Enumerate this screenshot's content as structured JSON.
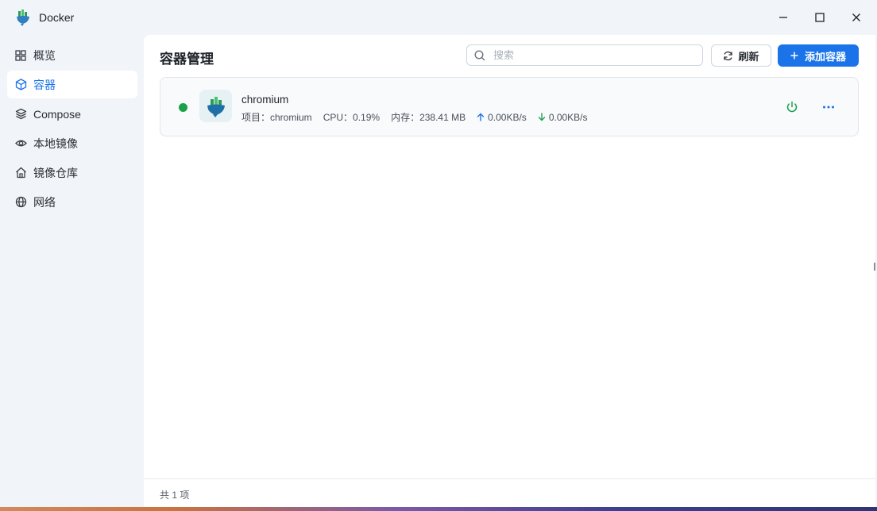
{
  "app": {
    "title": "Docker"
  },
  "window_controls": [
    "minimize",
    "maximize",
    "close"
  ],
  "sidebar": {
    "items": [
      {
        "label": "概览",
        "icon": "grid-icon",
        "active": false
      },
      {
        "label": "容器",
        "icon": "cube-icon",
        "active": true
      },
      {
        "label": "Compose",
        "icon": "layers-icon",
        "active": false
      },
      {
        "label": "本地镜像",
        "icon": "eye-icon",
        "active": false
      },
      {
        "label": "镜像仓库",
        "icon": "home-icon",
        "active": false
      },
      {
        "label": "网络",
        "icon": "globe-icon",
        "active": false
      }
    ]
  },
  "main": {
    "title": "容器管理",
    "search": {
      "placeholder": "搜索",
      "value": ""
    },
    "refresh_label": "刷新",
    "add_label": "添加容器"
  },
  "containers": [
    {
      "name": "chromium",
      "status": "running",
      "project_text": "项目：chromium",
      "cpu_text": "CPU：0.19%",
      "memory_text": "内存：238.41 MB",
      "upload_text": "0.00KB/s",
      "download_text": "0.00KB/s"
    }
  ],
  "footer": {
    "count_text": "共 1 项"
  },
  "colors": {
    "accent": "#1a73e8",
    "running": "#1aa14a",
    "power": "#1aa14a",
    "background": "#f1f4f9"
  }
}
